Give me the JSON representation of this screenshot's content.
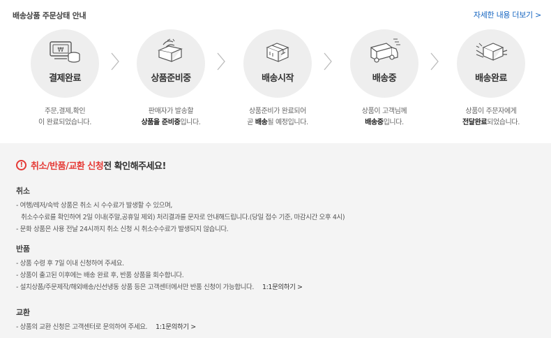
{
  "header": {
    "title": "배송상품 주문상태 안내",
    "more_link": "자세한 내용 더보기 >"
  },
  "steps": [
    {
      "label": "결제완료",
      "icon": "payment-icon",
      "desc1_pre": "주문,결제,확인",
      "desc1_bold": "",
      "desc1_post": "",
      "desc2_pre": "이 완료되었습니다.",
      "desc2_bold": "",
      "desc2_post": ""
    },
    {
      "label": "상품준비중",
      "icon": "product-prep-icon",
      "desc1_pre": "판매자가 발송할",
      "desc1_bold": "",
      "desc1_post": "",
      "desc2_pre": "",
      "desc2_bold": "상품을 준비중",
      "desc2_post": "입니다."
    },
    {
      "label": "배송시작",
      "icon": "box-icon",
      "desc1_pre": "상품준비가 완료되어",
      "desc1_bold": "",
      "desc1_post": "",
      "desc2_pre": "곧 ",
      "desc2_bold": "배송",
      "desc2_post": "될 예정입니다."
    },
    {
      "label": "배송중",
      "icon": "truck-icon",
      "desc1_pre": "상품이 고객님께",
      "desc1_bold": "",
      "desc1_post": "",
      "desc2_pre": "",
      "desc2_bold": "배송중",
      "desc2_post": "입니다."
    },
    {
      "label": "배송완료",
      "icon": "delivered-icon",
      "desc1_pre": "상품이 주문자에게",
      "desc1_bold": "",
      "desc1_post": "",
      "desc2_pre": "",
      "desc2_bold": "전달완료",
      "desc2_post": "되었습니다."
    }
  ],
  "notice": {
    "warn_icon": "!",
    "warn_red": "취소/반품/교환 신청",
    "warn_rest": "전 확인해주세요!",
    "cancel": {
      "title": "취소",
      "lines": [
        "- 여행/레저/숙박 상품은 취소 시 수수료가 발생할 수 있으며,",
        "  취소수수료를 확인하여 2일 이내(주말,공휴일 제외) 처리결과를 문자로 안내해드립니다.(당일 접수 기준, 마감시간 오후 4시)",
        "- 문화 상품은 사용 전날 24시까지 취소 신청 시 취소수수료가 발생되지 않습니다."
      ]
    },
    "return": {
      "title": "반품",
      "lines": [
        "- 상품 수령 후 7일 이내 신청하여 주세요.",
        "- 상품이 출고된 이후에는 배송 완료 후, 반품 상품을 회수합니다.",
        "- 설치상품/주문제작/해외배송/신선냉동 상품 등은 고객센터에서만 반품 신청이 가능합니다."
      ],
      "inquiry": "1:1문의하기 >"
    },
    "exchange": {
      "title": "교환",
      "lines": [
        "- 상품의 교환 신청은 고객센터로 문의하여 주세요."
      ],
      "inquiry": "1:1문의하기 >"
    }
  }
}
